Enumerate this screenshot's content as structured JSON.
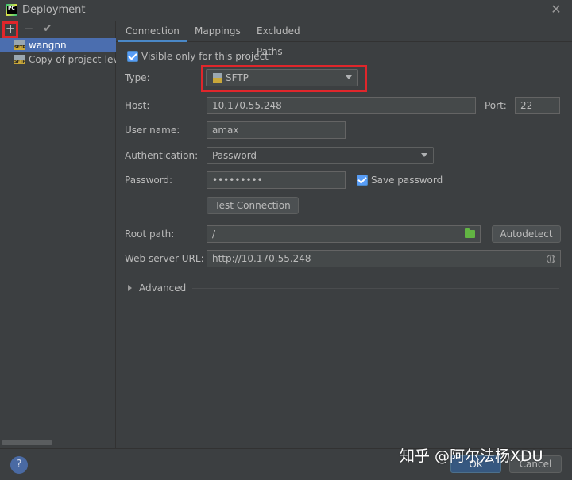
{
  "window": {
    "title": "Deployment",
    "app_icon": "pycharm-icon",
    "close_icon": "close-icon"
  },
  "left": {
    "toolbar": {
      "add": "+",
      "remove": "−",
      "apply": "✔"
    },
    "servers": [
      {
        "name": "wangnn",
        "type_badge": "SFTP",
        "selected": true
      },
      {
        "name": "Copy of project-level",
        "type_badge": "SFTP",
        "selected": false
      }
    ]
  },
  "tabs": [
    "Connection",
    "Mappings",
    "Excluded Paths"
  ],
  "active_tab": "Connection",
  "connection": {
    "visible_only_label": "Visible only for this project",
    "visible_only_checked": true,
    "type_label": "Type:",
    "type_value": "SFTP",
    "host_label": "Host:",
    "host_value": "10.170.55.248",
    "port_label": "Port:",
    "port_value": "22",
    "username_label": "User name:",
    "username_value": "amax",
    "auth_label": "Authentication:",
    "auth_value": "Password",
    "password_label": "Password:",
    "password_value": "•••••••••",
    "save_password_label": "Save password",
    "save_password_checked": true,
    "test_connection_label": "Test Connection",
    "root_path_label": "Root path:",
    "root_path_value": "/",
    "autodetect_label": "Autodetect",
    "web_url_label": "Web server URL:",
    "web_url_value": "http://10.170.55.248",
    "advanced_label": "Advanced"
  },
  "footer": {
    "help": "?",
    "ok_label": "OK",
    "cancel_label": "Cancel",
    "watermark": "知乎 @阿尔法杨XDU"
  },
  "colors": {
    "background": "#3c3f41",
    "selection": "#4b6eaf",
    "highlight_box": "#e0262b",
    "primary_button": "#365880",
    "tab_underline": "#4a88c7"
  }
}
